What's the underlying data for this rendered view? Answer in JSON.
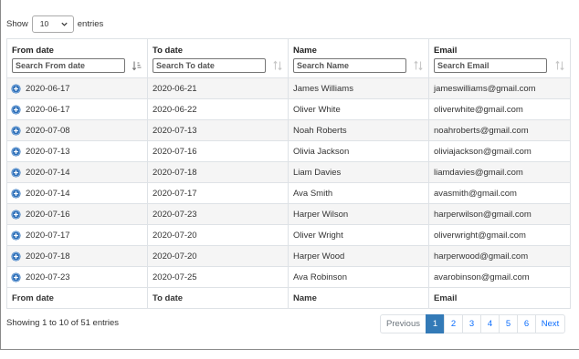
{
  "length_menu": {
    "before": "Show",
    "selected": "10",
    "after": "entries"
  },
  "columns": [
    {
      "title": "From date",
      "placeholder": "Search From date",
      "sort_icon": "sort-ascending-icon"
    },
    {
      "title": "To date",
      "placeholder": "Search To date",
      "sort_icon": "sort-both-icon"
    },
    {
      "title": "Name",
      "placeholder": "Search Name",
      "sort_icon": "sort-both-icon"
    },
    {
      "title": "Email",
      "placeholder": "Search Email",
      "sort_icon": "sort-both-icon"
    }
  ],
  "rows": [
    [
      "2020-06-17",
      "2020-06-21",
      "James Williams",
      "jameswilliams@gmail.com"
    ],
    [
      "2020-06-17",
      "2020-06-22",
      "Oliver White",
      "oliverwhite@gmail.com"
    ],
    [
      "2020-07-08",
      "2020-07-13",
      "Noah Roberts",
      "noahroberts@gmail.com"
    ],
    [
      "2020-07-13",
      "2020-07-16",
      "Olivia Jackson",
      "oliviajackson@gmail.com"
    ],
    [
      "2020-07-14",
      "2020-07-18",
      "Liam Davies",
      "liamdavies@gmail.com"
    ],
    [
      "2020-07-14",
      "2020-07-17",
      "Ava Smith",
      "avasmith@gmail.com"
    ],
    [
      "2020-07-16",
      "2020-07-23",
      "Harper Wilson",
      "harperwilson@gmail.com"
    ],
    [
      "2020-07-17",
      "2020-07-20",
      "Oliver Wright",
      "oliverwright@gmail.com"
    ],
    [
      "2020-07-18",
      "2020-07-20",
      "Harper Wood",
      "harperwood@gmail.com"
    ],
    [
      "2020-07-23",
      "2020-07-25",
      "Ava Robinson",
      "avarobinson@gmail.com"
    ]
  ],
  "footer": [
    "From date",
    "To date",
    "Name",
    "Email"
  ],
  "info": "Showing 1 to 10 of 51 entries",
  "pagination": {
    "previous": "Previous",
    "pages": [
      "1",
      "2",
      "3",
      "4",
      "5",
      "6"
    ],
    "active": "1",
    "next": "Next"
  },
  "colors": {
    "accent": "#337ab7",
    "link": "#0d6efd",
    "stripe": "#f5f5f5",
    "expand": "#2e6fb7"
  }
}
